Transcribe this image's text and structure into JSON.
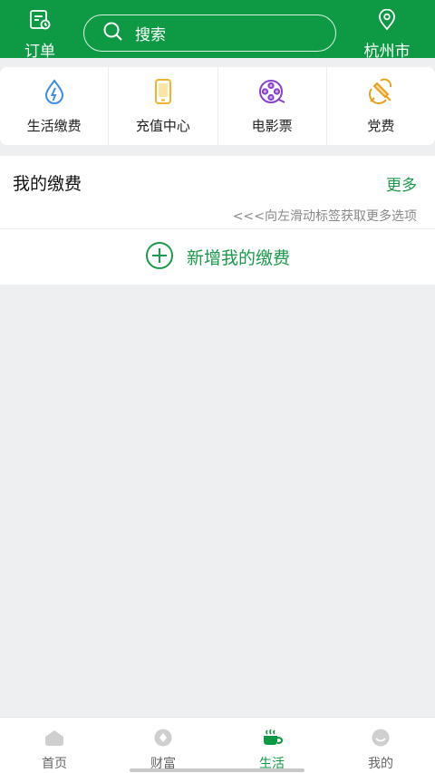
{
  "header": {
    "orders_label": "订单",
    "search_placeholder": "搜索",
    "city": "杭州市"
  },
  "quick_actions": [
    {
      "label": "生活缴费",
      "icon": "water-electric-icon",
      "color": "#3a8ee6"
    },
    {
      "label": "充值中心",
      "icon": "phone-recharge-icon",
      "color": "#f2b42c"
    },
    {
      "label": "电影票",
      "icon": "film-reel-icon",
      "color": "#8a3fcf"
    },
    {
      "label": "党费",
      "icon": "party-emblem-icon",
      "color": "#e8a020"
    }
  ],
  "my_payments": {
    "title": "我的缴费",
    "more": "更多",
    "hint": "<<<向左滑动标签获取更多选项",
    "add_label": "新增我的缴费"
  },
  "tabs": [
    {
      "label": "首页",
      "icon": "home-icon",
      "active": false
    },
    {
      "label": "财富",
      "icon": "wealth-icon",
      "active": false
    },
    {
      "label": "生活",
      "icon": "coffee-cup-icon",
      "active": true
    },
    {
      "label": "我的",
      "icon": "profile-icon",
      "active": false
    }
  ],
  "colors": {
    "brand": "#0e9a44",
    "accent_text": "#1a9a4a"
  }
}
